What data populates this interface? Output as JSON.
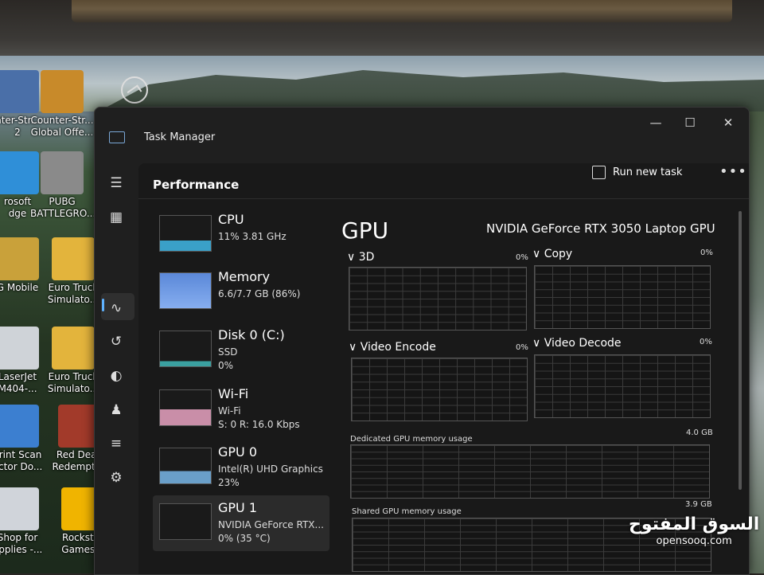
{
  "desktop": {
    "icons": [
      {
        "label": "nter-Str...",
        "label2": "2",
        "color": "#4a6fa8"
      },
      {
        "label": "Counter-Str...",
        "label2": "Global Offe...",
        "color": "#c88a2a"
      },
      {
        "label": "rosoft",
        "label2": "dge",
        "color": "#2f8fd8"
      },
      {
        "label": "PUBG",
        "label2": "BATTLEGRO...",
        "color": "#8a8a8a"
      },
      {
        "label": "G Mobile",
        "label2": "",
        "color": "#c9a13a"
      },
      {
        "label": "Euro Truck",
        "label2": "Simulato...",
        "color": "#e3b43c"
      },
      {
        "label": "LaserJet",
        "label2": "M404-...",
        "color": "#cfd3d8"
      },
      {
        "label": "Euro Truck",
        "label2": "Simulato...",
        "color": "#e3b43c"
      },
      {
        "label": "Print Scan",
        "label2": "octor Do...",
        "color": "#3c7fd0"
      },
      {
        "label": "Red Dead",
        "label2": "Redempti...",
        "color": "#a23a2a"
      },
      {
        "label": "Shop for",
        "label2": "upplies -...",
        "color": "#d0d4da"
      },
      {
        "label": "Rockstar",
        "label2": "Games...",
        "color": "#f0b400"
      }
    ]
  },
  "window": {
    "title": "Task Manager",
    "minimize": "—",
    "maximize": "☐",
    "close": "✕"
  },
  "toolbar": {
    "section_title": "Performance",
    "run_task_label": "Run new task",
    "more_label": "•••"
  },
  "rail_icons": [
    "hamburger-icon",
    "processes-icon",
    "performance-icon",
    "app-history-icon",
    "startup-apps-icon",
    "users-icon",
    "details-icon",
    "services-icon"
  ],
  "resources": [
    {
      "name": "CPU",
      "line1": "11%  3.81 GHz",
      "line2": ""
    },
    {
      "name": "Memory",
      "line1": "6.6/7.7 GB (86%)",
      "line2": ""
    },
    {
      "name": "Disk 0 (C:)",
      "line1": "SSD",
      "line2": "0%"
    },
    {
      "name": "Wi-Fi",
      "line1": "Wi-Fi",
      "line2": "S: 0  R: 16.0 Kbps"
    },
    {
      "name": "GPU 0",
      "line1": "Intel(R) UHD Graphics",
      "line2": "23%"
    },
    {
      "name": "GPU 1",
      "line1": "NVIDIA GeForce RTX...",
      "line2": "0%  (35 °C)"
    }
  ],
  "gpu": {
    "title": "GPU",
    "name": "NVIDIA GeForce RTX 3050 Laptop GPU",
    "engines": [
      {
        "label": "∨ 3D",
        "pct": "0%"
      },
      {
        "label": "∨ Copy",
        "pct": "0%"
      },
      {
        "label": "∨ Video Encode",
        "pct": "0%"
      },
      {
        "label": "∨ Video Decode",
        "pct": "0%"
      }
    ],
    "dedicated_label": "Dedicated GPU memory usage",
    "dedicated_max": "4.0 GB",
    "shared_label": "Shared GPU memory usage",
    "shared_max": "3.9 GB"
  },
  "watermark": {
    "arabic": "السوق المفتوح",
    "latin": "opensooq.com"
  }
}
